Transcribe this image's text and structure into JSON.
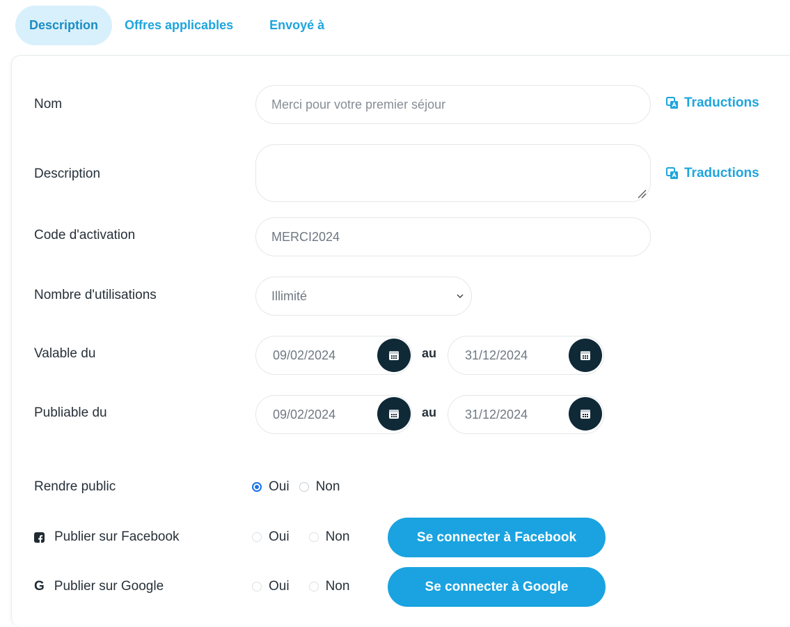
{
  "tabs": [
    {
      "label": "Description",
      "active": true
    },
    {
      "label": "Offres applicables",
      "active": false
    },
    {
      "label": "Envoyé à",
      "active": false
    }
  ],
  "form": {
    "nom": {
      "label": "Nom",
      "placeholder": "Merci pour votre premier séjour"
    },
    "description": {
      "label": "Description",
      "value": ""
    },
    "translations_label": "Traductions",
    "code": {
      "label": "Code d'activation",
      "value": "MERCI2024"
    },
    "usage": {
      "label": "Nombre d'utilisations",
      "selected": "Illimité"
    },
    "valid": {
      "label": "Valable du",
      "from": "09/02/2024",
      "to": "31/12/2024",
      "separator": "au"
    },
    "publishable": {
      "label": "Publiable du",
      "from": "09/02/2024",
      "to": "31/12/2024",
      "separator": "au"
    },
    "public": {
      "label": "Rendre public",
      "yes": "Oui",
      "no": "Non",
      "selected": "Oui"
    },
    "facebook": {
      "label": "Publier sur Facebook",
      "yes": "Oui",
      "no": "Non",
      "button": "Se connecter à Facebook"
    },
    "google": {
      "label": "Publier sur Google",
      "yes": "Oui",
      "no": "Non",
      "button": "Se connecter à Google",
      "icon_letter": "G"
    }
  },
  "colors": {
    "accent": "#1aa3e0",
    "tab_active_bg": "#d8f0fb",
    "calendar_button": "#0f2937",
    "radio_selected": "#1a73e8"
  },
  "icons": {
    "translation": "translate-icon",
    "calendar": "calendar-icon",
    "dropdown": "chevron-down-icon",
    "facebook": "facebook-icon",
    "google": "google-icon"
  }
}
